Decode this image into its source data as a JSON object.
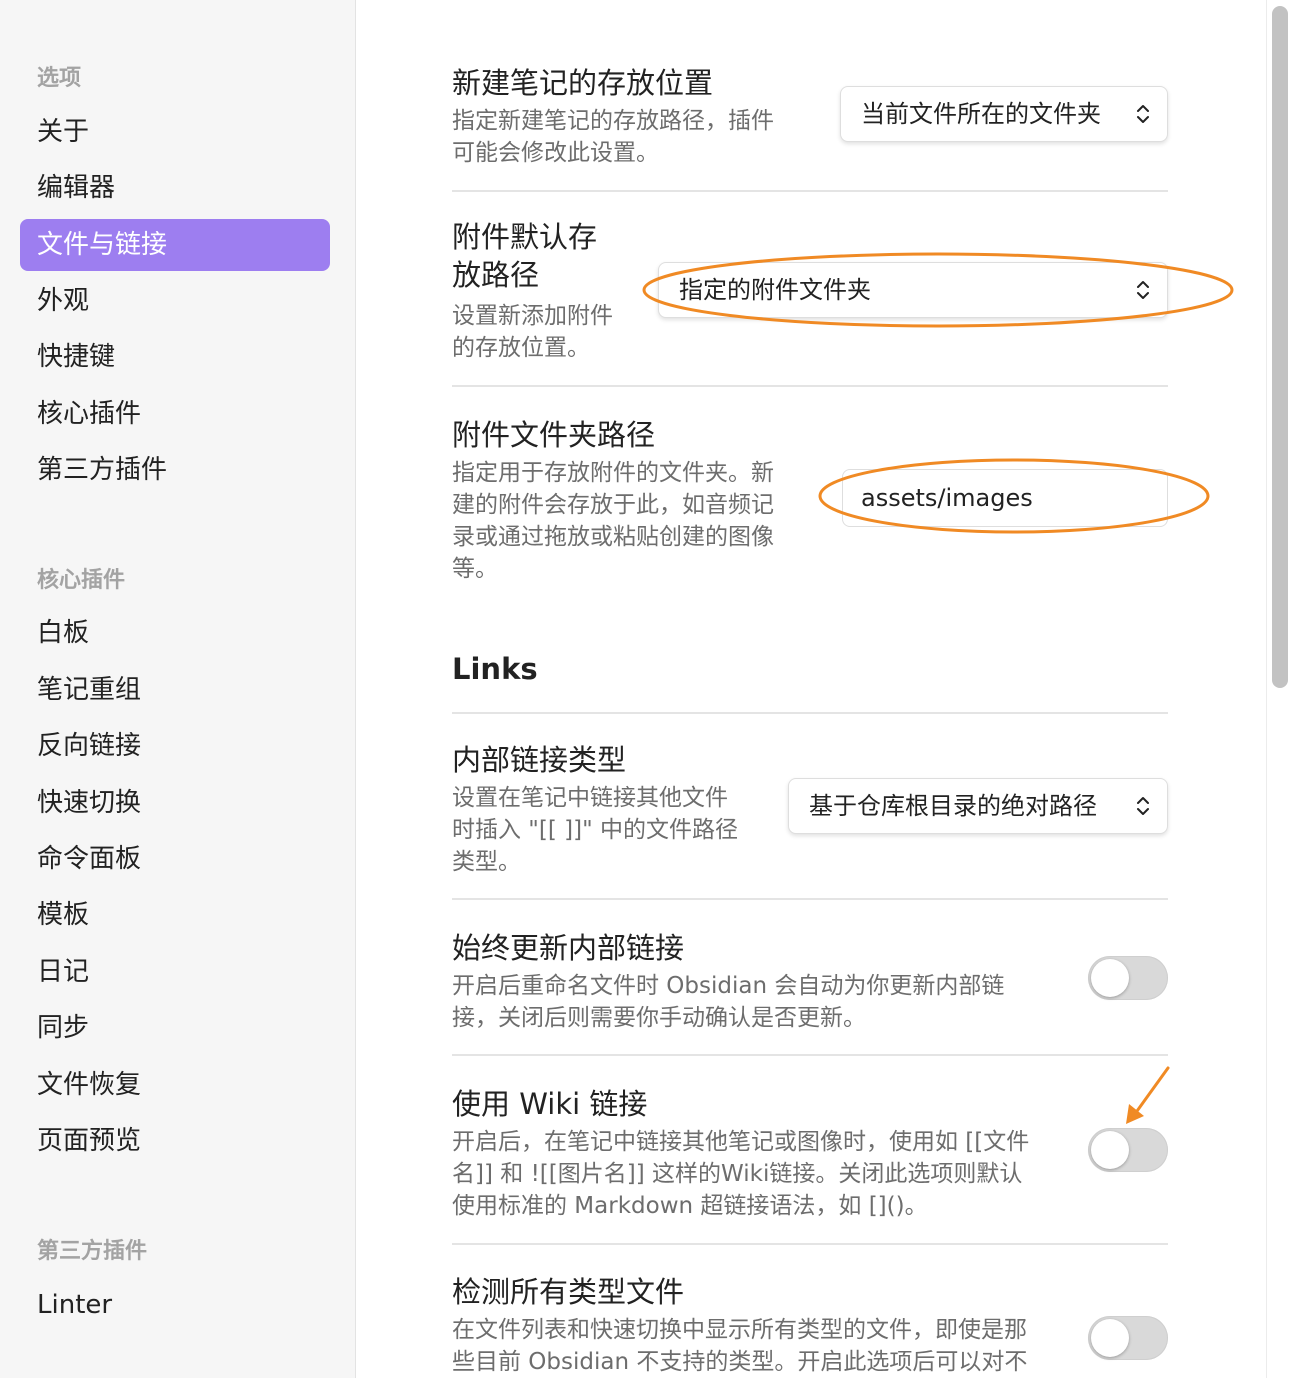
{
  "sidebar": {
    "group_options": "选项",
    "options_items": [
      "关于",
      "编辑器",
      "文件与链接",
      "外观",
      "快捷键",
      "核心插件",
      "第三方插件"
    ],
    "group_core": "核心插件",
    "core_items": [
      "白板",
      "笔记重组",
      "反向链接",
      "快速切换",
      "命令面板",
      "模板",
      "日记",
      "同步",
      "文件恢复",
      "页面预览"
    ],
    "group_third": "第三方插件",
    "third_items": [
      "Linter"
    ]
  },
  "settings": {
    "new_note_location": {
      "title": "新建笔记的存放位置",
      "desc_line1": "指定新建笔记的存放路径，插件",
      "desc_line2": "可能会修改此设置。",
      "value": "当前文件所在的文件夹"
    },
    "attachment_location": {
      "title_line1": "附件默认存",
      "title_line2": "放路径",
      "desc_line1": "设置新添加附件",
      "desc_line2": "的存放位置。",
      "value": "指定的附件文件夹"
    },
    "attachment_folder": {
      "title": "附件文件夹路径",
      "desc_line1": "指定用于存放附件的文件夹。新",
      "desc_line2": "建的附件会存放于此，如音频记",
      "desc_line3": "录或通过拖放或粘贴创建的图像",
      "desc_line4": "等。",
      "value": "assets/images"
    },
    "links_heading": "Links",
    "link_type": {
      "title": "内部链接类型",
      "desc_line1": "设置在笔记中链接其他文件",
      "desc_line2": "时插入 \"[[ ]]\" 中的文件路径",
      "desc_line3": "类型。",
      "value": "基于仓库根目录的绝对路径"
    },
    "auto_update_links": {
      "title": "始终更新内部链接",
      "desc_line1": "开启后重命名文件时 Obsidian 会自动为你更新内部链",
      "desc_line2": "接，关闭后则需要你手动确认是否更新。",
      "enabled": false
    },
    "wiki_links": {
      "title": "使用 Wiki 链接",
      "desc_line1": "开启后，在笔记中链接其他笔记或图像时，使用如 [[文件",
      "desc_line2": "名]] 和 ![[图片名]] 这样的Wiki链接。关闭此选项则默认",
      "desc_line3": "使用标准的 Markdown 超链接语法，如 []()。",
      "enabled": false
    },
    "detect_all_files": {
      "title": "检测所有类型文件",
      "desc_line1": "在文件列表和快速切换中显示所有类型的文件，即使是那",
      "desc_line2": "些目前 Obsidian 不支持的类型。开启此选项后可以对不",
      "enabled": false
    }
  },
  "colors": {
    "accent": "#9d7ef0",
    "annotation": "#f08a24"
  }
}
